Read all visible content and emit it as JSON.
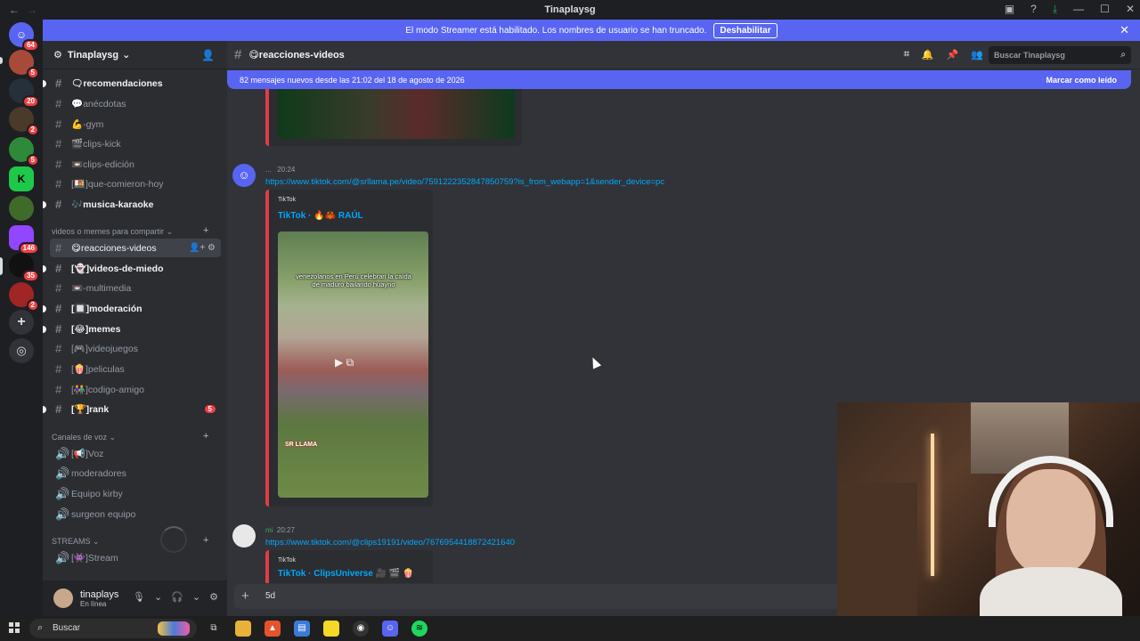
{
  "window": {
    "title": "Tinaplaysg"
  },
  "banner": {
    "text": "El modo Streamer está habilitado. Los nombres de usuario se han truncado.",
    "button": "Deshabilitar"
  },
  "servers": [
    {
      "badge": "64",
      "icon": "discord-home-icon"
    },
    {
      "badge": "5",
      "icon": "server-icon"
    },
    {
      "badge": "20",
      "icon": "server-icon"
    },
    {
      "badge": "2",
      "icon": "server-icon"
    },
    {
      "badge": "5",
      "icon": "server-icon"
    },
    {
      "badge": "",
      "icon": "kick-server-icon",
      "letter": "K"
    },
    {
      "badge": "",
      "icon": "server-icon"
    },
    {
      "badge": "146",
      "icon": "twitch-server-icon"
    },
    {
      "badge": "35",
      "icon": "server-icon"
    },
    {
      "badge": "2",
      "icon": "server-icon"
    }
  ],
  "sidebar": {
    "server_name": "Tinaplaysg",
    "channels_top": [
      {
        "label": "🗨recomendaciones",
        "unread": true
      },
      {
        "label": "💬anécdotas",
        "unread": false
      },
      {
        "label": "💪-gym",
        "unread": false
      },
      {
        "label": "🎬clips-kick",
        "unread": false
      },
      {
        "label": "📼clips-edición",
        "unread": false
      },
      {
        "label": "[🍱]que-comieron-hoy",
        "unread": false
      },
      {
        "label": "🎶musica-karaoke",
        "unread": true
      }
    ],
    "category_memes": "videos o memes para compartir",
    "channels_memes": [
      {
        "label": "😋reacciones-videos",
        "active": true
      },
      {
        "label": "[👻]videos-de-miedo",
        "unread": true
      },
      {
        "label": "📼-multimedia",
        "unread": false
      },
      {
        "label": "[🔲]moderación",
        "unread": true
      },
      {
        "label": "[😂]memes",
        "unread": true
      },
      {
        "label": "[🎮]videojuegos",
        "unread": false
      },
      {
        "label": "[🍿]peliculas",
        "unread": false
      },
      {
        "label": "[👫]codigo-amigo",
        "unread": false
      },
      {
        "label": "[🏆]rank",
        "unread": true,
        "badge": "5"
      }
    ],
    "category_voice": "Canales de voz",
    "voice_channels": [
      "[📢]Voz",
      "moderadores",
      "Equipo kirby",
      "surgeon equipo"
    ],
    "category_streams": "STREAMS",
    "stream_channels": [
      "[👾]Stream"
    ]
  },
  "user": {
    "name": "tinaplays",
    "status": "En línea"
  },
  "channel": {
    "name": "😋reacciones-videos",
    "search_placeholder": "Buscar Tinaplaysg"
  },
  "new_messages": {
    "text": "82 mensajes nuevos desde las 21:02 del 18 de agosto de 2026",
    "mark": "Marcar como leído"
  },
  "messages": [
    {
      "author": "...",
      "time": "20:24",
      "link": "https://www.tiktok.com/@srllama.pe/video/7591222352847850759?is_from_webapp=1&sender_device=pc",
      "provider": "TikTok",
      "embed_title": "TikTok · 🔥🦀 RAÚL",
      "video_caption": "venezolanos en Perú celebran la caída de maduro bailando huayno",
      "watermark": "SR LLAMA"
    },
    {
      "author": "mi",
      "time": "20:27",
      "link": "https://www.tiktok.com/@clips19191/video/7676954418872421640",
      "provider": "TikTok",
      "embed_title": "TikTok · ClipsUniverse 🎥 🎬 🍿"
    }
  ],
  "composer": {
    "value": "5d"
  },
  "taskbar": {
    "search_placeholder": "Buscar"
  }
}
